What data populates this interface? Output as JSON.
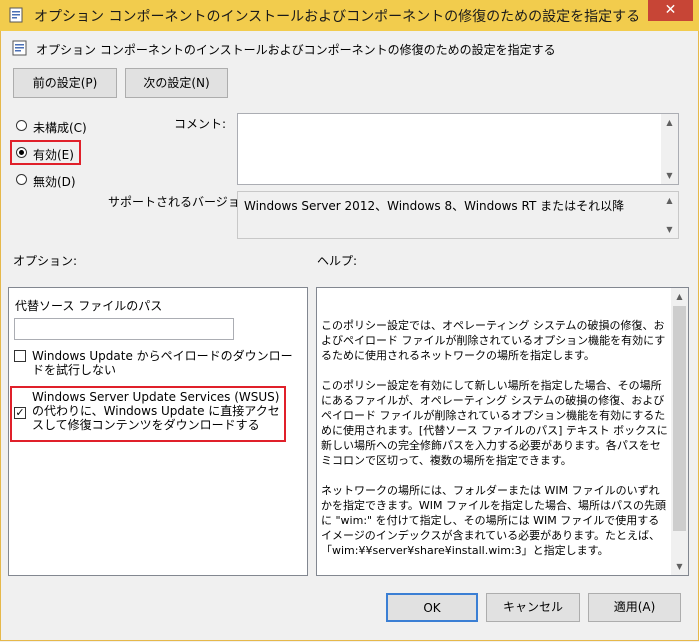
{
  "window": {
    "title": "オプション コンポーネントのインストールおよびコンポーネントの修復のための設定を指定する",
    "close_label": "✕"
  },
  "header": {
    "text": "オプション コンポーネントのインストールおよびコンポーネントの修復のための設定を指定する"
  },
  "nav": {
    "prev_label": "前の設定(P)",
    "next_label": "次の設定(N)"
  },
  "state": {
    "not_configured_label": "未構成(C)",
    "enabled_label": "有効(E)",
    "disabled_label": "無効(D)",
    "selected": "enabled"
  },
  "comment": {
    "label": "コメント:",
    "value": ""
  },
  "supported": {
    "label": "サポートされるバージョン:",
    "value": "Windows Server 2012、Windows 8、Windows RT またはそれ以降"
  },
  "options": {
    "label": "オプション:",
    "alt_source_label": "代替ソース ファイルのパス",
    "alt_source_value": "",
    "never_download_label": "Windows  Update からペイロードのダウンロードを試行しない",
    "never_download_checked": false,
    "wsus_label": "Windows Server Update Services (WSUS) の代わりに、Windows  Update に直接アクセスして修復コンテンツをダウンロードする",
    "wsus_checked": true
  },
  "help": {
    "label": "ヘルプ:",
    "p1": "このポリシー設定では、オペレーティング システムの破損の修復、およびペイロード ファイルが削除されているオプション機能を有効にするために使用されるネットワークの場所を指定します。",
    "p2": "このポリシー設定を有効にして新しい場所を指定した場合、その場所にあるファイルが、オペレーティング システムの破損の修復、およびペイロード ファイルが削除されているオプション機能を有効にするために使用されます。[代替ソース ファイルのパス] テキスト ボックスに新しい場所への完全修飾パスを入力する必要があります。各パスをセミコロンで区切って、複数の場所を指定できます。",
    "p3": "ネットワークの場所には、フォルダーまたは WIM ファイルのいずれかを指定できます。WIM ファイルを指定した場合、場所はパスの先頭に \"wim:\" を付けて指定し、その場所には WIM ファイルで使用するイメージのインデックスが含まれている必要があります。たとえば、「wim:¥¥server¥share¥install.wim:3」と指定します。"
  },
  "footer": {
    "ok_label": "OK",
    "cancel_label": "キャンセル",
    "apply_label": "適用(A)"
  },
  "colors": {
    "title_bar": "#f2cc4d",
    "close_button": "#c74536",
    "highlight": "#e0202a"
  }
}
